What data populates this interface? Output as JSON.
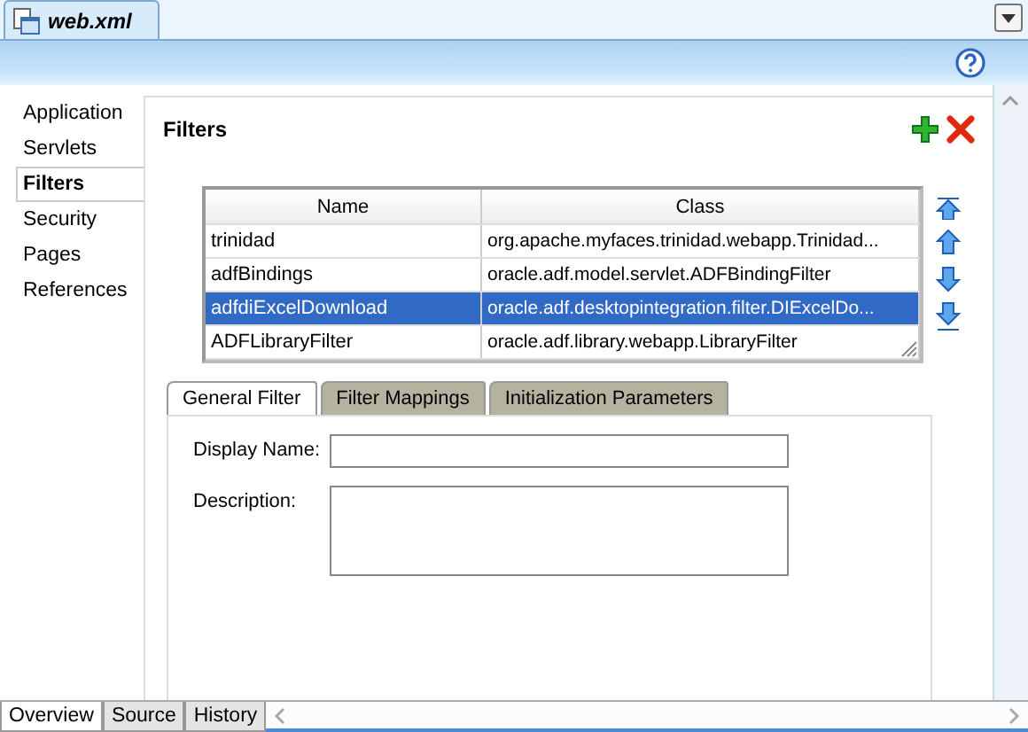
{
  "file_tab": {
    "label": "web.xml",
    "selected": true
  },
  "nav": [
    {
      "label": "Application",
      "selected": false
    },
    {
      "label": "Servlets",
      "selected": false
    },
    {
      "label": "Filters",
      "selected": true
    },
    {
      "label": "Security",
      "selected": false
    },
    {
      "label": "Pages",
      "selected": false
    },
    {
      "label": "References",
      "selected": false
    }
  ],
  "section": {
    "title": "Filters"
  },
  "table": {
    "columns": [
      "Name",
      "Class"
    ],
    "rows": [
      {
        "name": "trinidad",
        "class": "org.apache.myfaces.trinidad.webapp.Trinidad...",
        "selected": false
      },
      {
        "name": "adfBindings",
        "class": "oracle.adf.model.servlet.ADFBindingFilter",
        "selected": false
      },
      {
        "name": "adfdiExcelDownload",
        "class": "oracle.adf.desktopintegration.filter.DIExcelDo...",
        "selected": true
      },
      {
        "name": "ADFLibraryFilter",
        "class": "oracle.adf.library.webapp.LibraryFilter",
        "selected": false
      }
    ]
  },
  "detail_tabs": [
    {
      "label": "General Filter",
      "selected": true
    },
    {
      "label": "Filter Mappings",
      "selected": false
    },
    {
      "label": "Initialization Parameters",
      "selected": false
    }
  ],
  "fields": [
    {
      "label": "Display Name:",
      "kind": "input"
    },
    {
      "label": "Description:",
      "kind": "textarea"
    }
  ],
  "bottom_tabs": [
    {
      "label": "Overview",
      "selected": true
    },
    {
      "label": "Source",
      "selected": false
    },
    {
      "label": "History",
      "selected": false
    }
  ]
}
